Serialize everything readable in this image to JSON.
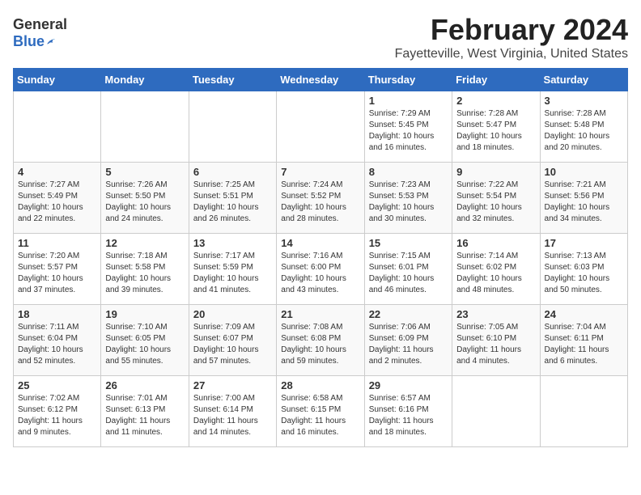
{
  "header": {
    "logo_general": "General",
    "logo_blue": "Blue",
    "title": "February 2024",
    "subtitle": "Fayetteville, West Virginia, United States"
  },
  "weekdays": [
    "Sunday",
    "Monday",
    "Tuesday",
    "Wednesday",
    "Thursday",
    "Friday",
    "Saturday"
  ],
  "weeks": [
    {
      "shade": "light",
      "days": [
        {
          "num": "",
          "info": ""
        },
        {
          "num": "",
          "info": ""
        },
        {
          "num": "",
          "info": ""
        },
        {
          "num": "",
          "info": ""
        },
        {
          "num": "1",
          "info": "Sunrise: 7:29 AM\nSunset: 5:45 PM\nDaylight: 10 hours\nand 16 minutes."
        },
        {
          "num": "2",
          "info": "Sunrise: 7:28 AM\nSunset: 5:47 PM\nDaylight: 10 hours\nand 18 minutes."
        },
        {
          "num": "3",
          "info": "Sunrise: 7:28 AM\nSunset: 5:48 PM\nDaylight: 10 hours\nand 20 minutes."
        }
      ]
    },
    {
      "shade": "dark",
      "days": [
        {
          "num": "4",
          "info": "Sunrise: 7:27 AM\nSunset: 5:49 PM\nDaylight: 10 hours\nand 22 minutes."
        },
        {
          "num": "5",
          "info": "Sunrise: 7:26 AM\nSunset: 5:50 PM\nDaylight: 10 hours\nand 24 minutes."
        },
        {
          "num": "6",
          "info": "Sunrise: 7:25 AM\nSunset: 5:51 PM\nDaylight: 10 hours\nand 26 minutes."
        },
        {
          "num": "7",
          "info": "Sunrise: 7:24 AM\nSunset: 5:52 PM\nDaylight: 10 hours\nand 28 minutes."
        },
        {
          "num": "8",
          "info": "Sunrise: 7:23 AM\nSunset: 5:53 PM\nDaylight: 10 hours\nand 30 minutes."
        },
        {
          "num": "9",
          "info": "Sunrise: 7:22 AM\nSunset: 5:54 PM\nDaylight: 10 hours\nand 32 minutes."
        },
        {
          "num": "10",
          "info": "Sunrise: 7:21 AM\nSunset: 5:56 PM\nDaylight: 10 hours\nand 34 minutes."
        }
      ]
    },
    {
      "shade": "light",
      "days": [
        {
          "num": "11",
          "info": "Sunrise: 7:20 AM\nSunset: 5:57 PM\nDaylight: 10 hours\nand 37 minutes."
        },
        {
          "num": "12",
          "info": "Sunrise: 7:18 AM\nSunset: 5:58 PM\nDaylight: 10 hours\nand 39 minutes."
        },
        {
          "num": "13",
          "info": "Sunrise: 7:17 AM\nSunset: 5:59 PM\nDaylight: 10 hours\nand 41 minutes."
        },
        {
          "num": "14",
          "info": "Sunrise: 7:16 AM\nSunset: 6:00 PM\nDaylight: 10 hours\nand 43 minutes."
        },
        {
          "num": "15",
          "info": "Sunrise: 7:15 AM\nSunset: 6:01 PM\nDaylight: 10 hours\nand 46 minutes."
        },
        {
          "num": "16",
          "info": "Sunrise: 7:14 AM\nSunset: 6:02 PM\nDaylight: 10 hours\nand 48 minutes."
        },
        {
          "num": "17",
          "info": "Sunrise: 7:13 AM\nSunset: 6:03 PM\nDaylight: 10 hours\nand 50 minutes."
        }
      ]
    },
    {
      "shade": "dark",
      "days": [
        {
          "num": "18",
          "info": "Sunrise: 7:11 AM\nSunset: 6:04 PM\nDaylight: 10 hours\nand 52 minutes."
        },
        {
          "num": "19",
          "info": "Sunrise: 7:10 AM\nSunset: 6:05 PM\nDaylight: 10 hours\nand 55 minutes."
        },
        {
          "num": "20",
          "info": "Sunrise: 7:09 AM\nSunset: 6:07 PM\nDaylight: 10 hours\nand 57 minutes."
        },
        {
          "num": "21",
          "info": "Sunrise: 7:08 AM\nSunset: 6:08 PM\nDaylight: 10 hours\nand 59 minutes."
        },
        {
          "num": "22",
          "info": "Sunrise: 7:06 AM\nSunset: 6:09 PM\nDaylight: 11 hours\nand 2 minutes."
        },
        {
          "num": "23",
          "info": "Sunrise: 7:05 AM\nSunset: 6:10 PM\nDaylight: 11 hours\nand 4 minutes."
        },
        {
          "num": "24",
          "info": "Sunrise: 7:04 AM\nSunset: 6:11 PM\nDaylight: 11 hours\nand 6 minutes."
        }
      ]
    },
    {
      "shade": "light",
      "days": [
        {
          "num": "25",
          "info": "Sunrise: 7:02 AM\nSunset: 6:12 PM\nDaylight: 11 hours\nand 9 minutes."
        },
        {
          "num": "26",
          "info": "Sunrise: 7:01 AM\nSunset: 6:13 PM\nDaylight: 11 hours\nand 11 minutes."
        },
        {
          "num": "27",
          "info": "Sunrise: 7:00 AM\nSunset: 6:14 PM\nDaylight: 11 hours\nand 14 minutes."
        },
        {
          "num": "28",
          "info": "Sunrise: 6:58 AM\nSunset: 6:15 PM\nDaylight: 11 hours\nand 16 minutes."
        },
        {
          "num": "29",
          "info": "Sunrise: 6:57 AM\nSunset: 6:16 PM\nDaylight: 11 hours\nand 18 minutes."
        },
        {
          "num": "",
          "info": ""
        },
        {
          "num": "",
          "info": ""
        }
      ]
    }
  ]
}
